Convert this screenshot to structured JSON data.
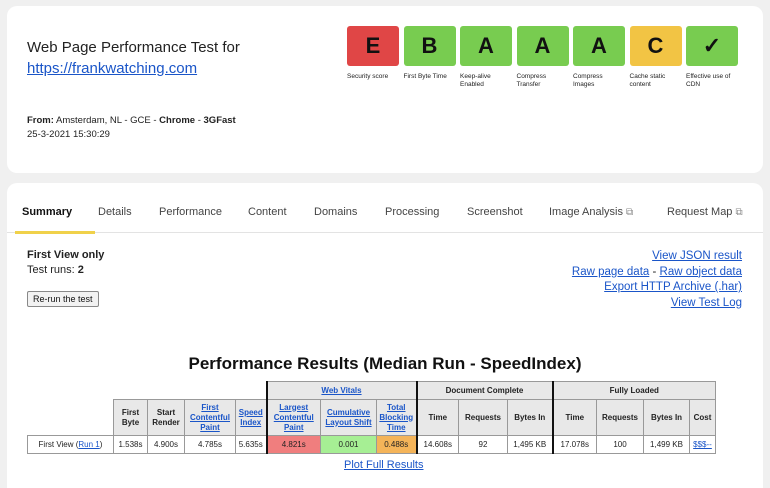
{
  "header": {
    "title_line": "Web Page Performance Test for",
    "url": "https://frankwatching.com",
    "from_label": "From:",
    "from_location": "Amsterdam, NL - GCE - ",
    "browser": "Chrome",
    "sep": " - ",
    "connection": "3GFast",
    "timestamp": "25-3-2021 15:30:29"
  },
  "grades": [
    {
      "letter": "E",
      "label": "Security score",
      "color": "#e04646"
    },
    {
      "letter": "B",
      "label": "First Byte Time",
      "color": "#78cc50"
    },
    {
      "letter": "A",
      "label": "Keep-alive Enabled",
      "color": "#78cc50"
    },
    {
      "letter": "A",
      "label": "Compress Transfer",
      "color": "#78cc50"
    },
    {
      "letter": "A",
      "label": "Compress Images",
      "color": "#78cc50"
    },
    {
      "letter": "C",
      "label": "Cache static content",
      "color": "#f2c444"
    },
    {
      "letter": "✓",
      "label": "Effective use of CDN",
      "color": "#78cc50"
    }
  ],
  "tabs": [
    {
      "label": "Summary"
    },
    {
      "label": "Details"
    },
    {
      "label": "Performance"
    },
    {
      "label": "Content"
    },
    {
      "label": "Domains"
    },
    {
      "label": "Processing"
    },
    {
      "label": "Screenshot"
    },
    {
      "label": "Image Analysis"
    },
    {
      "label": "Request Map"
    }
  ],
  "summary": {
    "first_view_only": "First View only",
    "test_runs_label": "Test runs: ",
    "test_runs_value": "2",
    "rerun_button": "Re-run the test",
    "links": {
      "json": "View JSON result",
      "raw_page": "Raw page data",
      "dash": " - ",
      "raw_object": "Raw object data",
      "har": "Export HTTP Archive (.har)",
      "log": "View Test Log"
    },
    "results_title": "Performance Results (Median Run - SpeedIndex)",
    "plot_full": "Plot Full Results"
  },
  "table": {
    "groups": {
      "web_vitals": "Web Vitals",
      "document_complete": "Document Complete",
      "fully_loaded": "Fully Loaded"
    },
    "headers": {
      "first_byte": "First Byte",
      "start_render": "Start Render",
      "fcp": "First Contentful Paint",
      "speed_index": "Speed Index",
      "lcp": "Largest Contentful Paint",
      "cls": "Cumulative Layout Shift",
      "tbt": "Total Blocking Time",
      "dc_time": "Time",
      "dc_requests": "Requests",
      "dc_bytes": "Bytes In",
      "fl_time": "Time",
      "fl_requests": "Requests",
      "fl_bytes": "Bytes In",
      "cost": "Cost"
    },
    "row": {
      "label": "First View (",
      "run_link": "Run 1",
      "label_end": ")",
      "first_byte": "1.538s",
      "start_render": "4.900s",
      "fcp": "4.785s",
      "speed_index": "5.635s",
      "lcp": "4.821s",
      "cls": "0.001",
      "tbt": "0.488s",
      "dc_time": "14.608s",
      "dc_requests": "92",
      "dc_bytes": "1,495 KB",
      "fl_time": "17.078s",
      "fl_requests": "100",
      "fl_bytes": "1,499 KB",
      "cost": "$$$--"
    }
  }
}
